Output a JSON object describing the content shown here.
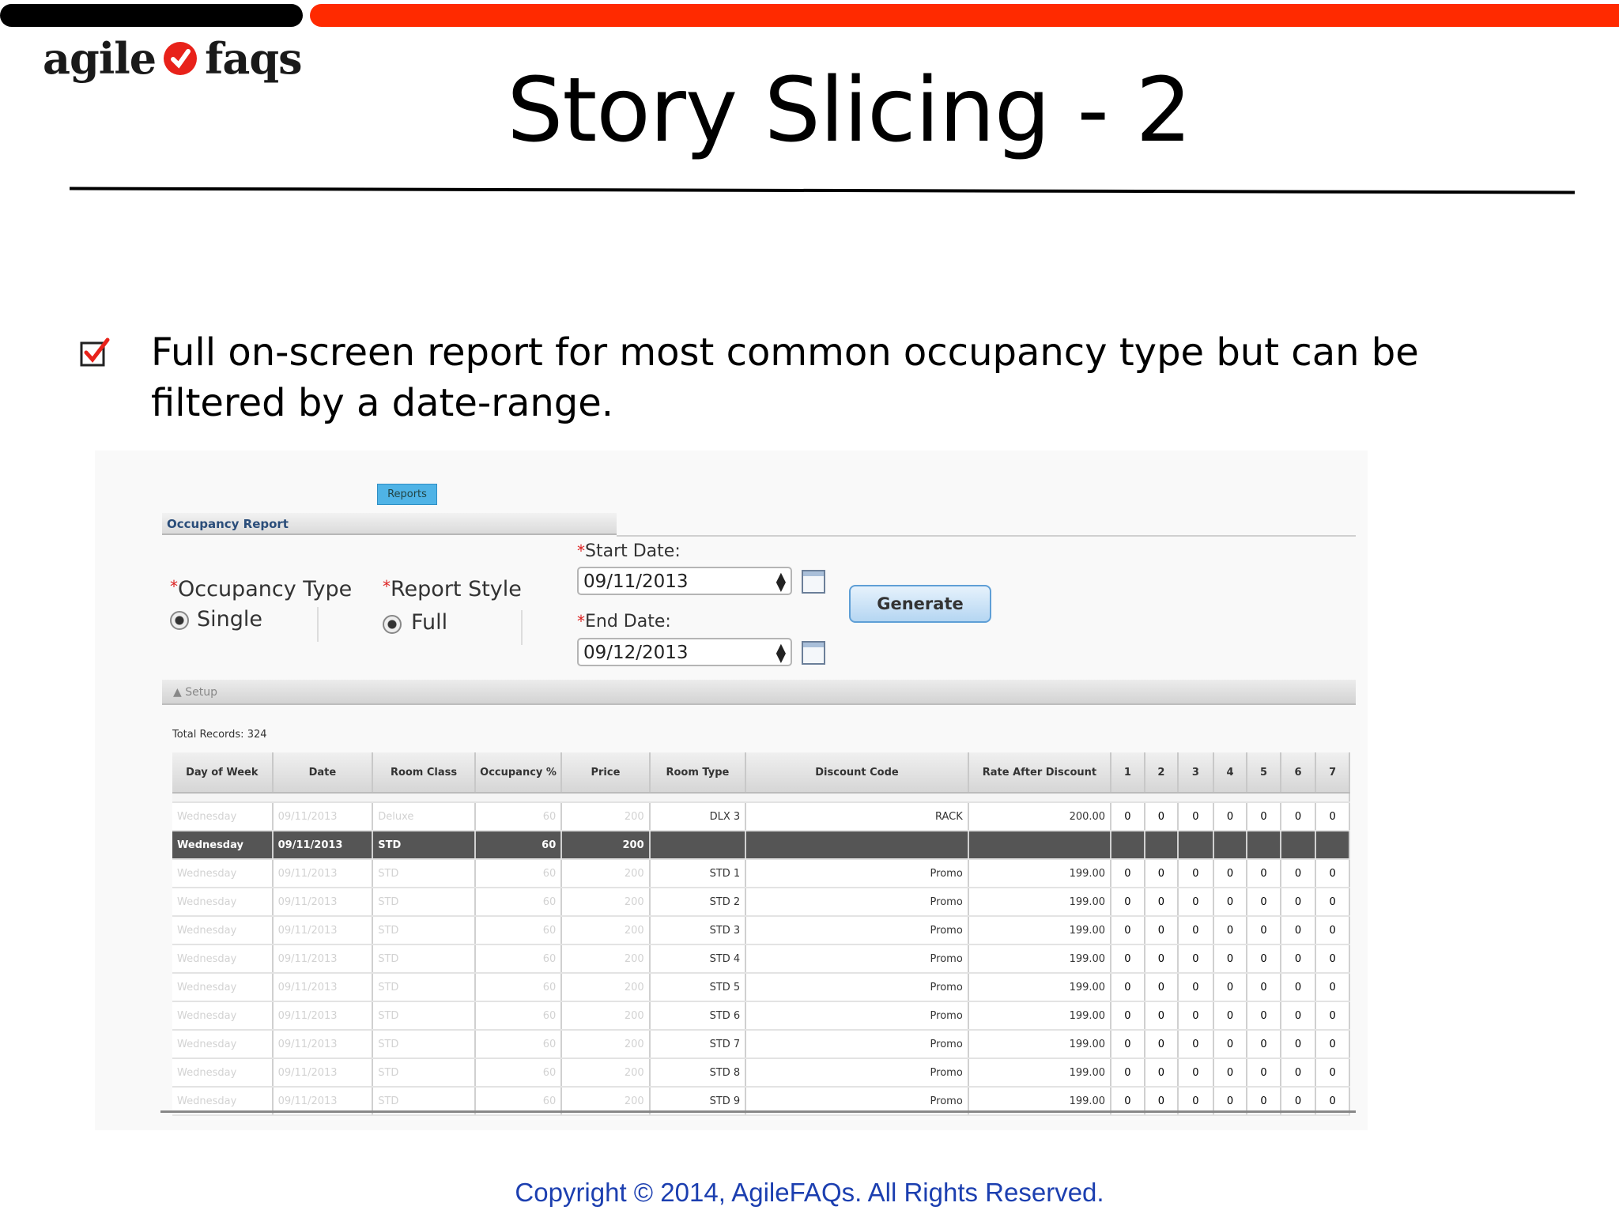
{
  "brand": {
    "logo_left": "agile",
    "logo_right": "faqs",
    "accent_red": "#ff2a00",
    "accent_black": "#000000"
  },
  "slide": {
    "title": "Story Slicing - 2",
    "bullet_icon": "checkbox-checked-icon",
    "bullet_text": "Full on-screen report for most common occupancy type but can be filtered by a date-range.",
    "copyright": "Copyright © 2014, AgileFAQs. All Rights Reserved."
  },
  "app": {
    "tab_label": "Reports",
    "section_title": "Occupancy Report",
    "occupancy_type_label": "Occupancy Type",
    "occupancy_type_value": "Single",
    "report_style_label": "Report Style",
    "report_style_value": "Full",
    "required_mark": "*",
    "start_date_label": "Start Date:",
    "start_date_value": "09/11/2013",
    "end_date_label": "End Date:",
    "end_date_value": "09/12/2013",
    "generate_label": "Generate",
    "setup_label": "Setup",
    "total_records": "Total Records: 324",
    "columns": [
      "Day of Week",
      "Date",
      "Room Class",
      "Occupancy %",
      "Price",
      "Room Type",
      "Discount Code",
      "Rate After Discount",
      "1",
      "2",
      "3",
      "4",
      "5",
      "6",
      "7"
    ],
    "first_row": {
      "day": "Wednesday",
      "date": "09/11/2013",
      "cls": "Deluxe",
      "occ": "60",
      "price": "200",
      "type": "DLX 3",
      "code": "RACK",
      "rate": "200.00",
      "d": [
        "0",
        "0",
        "0",
        "0",
        "0",
        "0",
        "0"
      ]
    },
    "selected_row": {
      "day": "Wednesday",
      "date": "09/11/2013",
      "cls": "STD",
      "occ": "60",
      "price": "200"
    },
    "rows": [
      {
        "day": "Wednesday",
        "date": "09/11/2013",
        "cls": "STD",
        "occ": "60",
        "price": "200",
        "type": "STD 1",
        "code": "Promo",
        "rate": "199.00",
        "d": [
          "0",
          "0",
          "0",
          "0",
          "0",
          "0",
          "0"
        ]
      },
      {
        "day": "Wednesday",
        "date": "09/11/2013",
        "cls": "STD",
        "occ": "60",
        "price": "200",
        "type": "STD 2",
        "code": "Promo",
        "rate": "199.00",
        "d": [
          "0",
          "0",
          "0",
          "0",
          "0",
          "0",
          "0"
        ]
      },
      {
        "day": "Wednesday",
        "date": "09/11/2013",
        "cls": "STD",
        "occ": "60",
        "price": "200",
        "type": "STD 3",
        "code": "Promo",
        "rate": "199.00",
        "d": [
          "0",
          "0",
          "0",
          "0",
          "0",
          "0",
          "0"
        ]
      },
      {
        "day": "Wednesday",
        "date": "09/11/2013",
        "cls": "STD",
        "occ": "60",
        "price": "200",
        "type": "STD 4",
        "code": "Promo",
        "rate": "199.00",
        "d": [
          "0",
          "0",
          "0",
          "0",
          "0",
          "0",
          "0"
        ]
      },
      {
        "day": "Wednesday",
        "date": "09/11/2013",
        "cls": "STD",
        "occ": "60",
        "price": "200",
        "type": "STD 5",
        "code": "Promo",
        "rate": "199.00",
        "d": [
          "0",
          "0",
          "0",
          "0",
          "0",
          "0",
          "0"
        ]
      },
      {
        "day": "Wednesday",
        "date": "09/11/2013",
        "cls": "STD",
        "occ": "60",
        "price": "200",
        "type": "STD 6",
        "code": "Promo",
        "rate": "199.00",
        "d": [
          "0",
          "0",
          "0",
          "0",
          "0",
          "0",
          "0"
        ]
      },
      {
        "day": "Wednesday",
        "date": "09/11/2013",
        "cls": "STD",
        "occ": "60",
        "price": "200",
        "type": "STD 7",
        "code": "Promo",
        "rate": "199.00",
        "d": [
          "0",
          "0",
          "0",
          "0",
          "0",
          "0",
          "0"
        ]
      },
      {
        "day": "Wednesday",
        "date": "09/11/2013",
        "cls": "STD",
        "occ": "60",
        "price": "200",
        "type": "STD 8",
        "code": "Promo",
        "rate": "199.00",
        "d": [
          "0",
          "0",
          "0",
          "0",
          "0",
          "0",
          "0"
        ]
      },
      {
        "day": "Wednesday",
        "date": "09/11/2013",
        "cls": "STD",
        "occ": "60",
        "price": "200",
        "type": "STD 9",
        "code": "Promo",
        "rate": "199.00",
        "d": [
          "0",
          "0",
          "0",
          "0",
          "0",
          "0",
          "0"
        ]
      }
    ]
  }
}
